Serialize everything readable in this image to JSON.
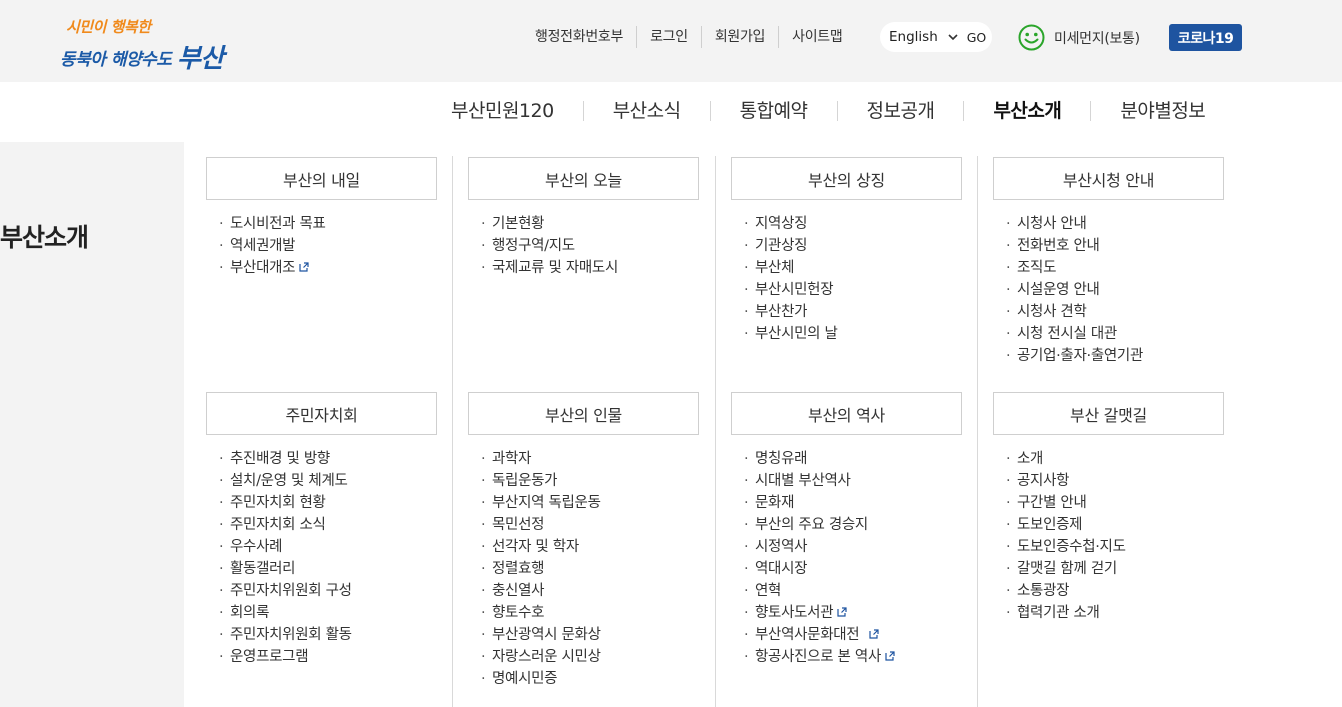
{
  "logo": {
    "line1": "시민이 행복한",
    "line2": "동북아 해양수도",
    "line2_big": "부산"
  },
  "util_links": [
    "행정전화번호부",
    "로그인",
    "회원가입",
    "사이트맵"
  ],
  "language": {
    "selected": "English",
    "go": "GO"
  },
  "dust": {
    "label": "미세먼지(보통)",
    "color": "#2aa52a"
  },
  "covid_button": "코로나19",
  "gnb": [
    {
      "label": "부산민원120",
      "active": false
    },
    {
      "label": "부산소식",
      "active": false
    },
    {
      "label": "통합예약",
      "active": false
    },
    {
      "label": "정보공개",
      "active": false
    },
    {
      "label": "부산소개",
      "active": true
    },
    {
      "label": "분야별정보",
      "active": false
    }
  ],
  "side_title": "부산소개",
  "sections": [
    {
      "title": "부산의 내일",
      "items": [
        {
          "label": "도시비전과 목표"
        },
        {
          "label": "역세권개발"
        },
        {
          "label": "부산대개조",
          "external": true
        }
      ]
    },
    {
      "title": "부산의 오늘",
      "items": [
        {
          "label": "기본현황"
        },
        {
          "label": "행정구역/지도"
        },
        {
          "label": "국제교류 및 자매도시"
        }
      ]
    },
    {
      "title": "부산의 상징",
      "items": [
        {
          "label": "지역상징"
        },
        {
          "label": "기관상징"
        },
        {
          "label": "부산체"
        },
        {
          "label": "부산시민헌장"
        },
        {
          "label": "부산찬가"
        },
        {
          "label": "부산시민의 날"
        }
      ]
    },
    {
      "title": "부산시청 안내",
      "items": [
        {
          "label": "시청사 안내"
        },
        {
          "label": "전화번호 안내"
        },
        {
          "label": "조직도"
        },
        {
          "label": "시설운영 안내"
        },
        {
          "label": "시청사 견학"
        },
        {
          "label": "시청 전시실 대관"
        },
        {
          "label": "공기업·출자·출연기관"
        }
      ]
    },
    {
      "title": "주민자치회",
      "items": [
        {
          "label": "추진배경 및 방향"
        },
        {
          "label": "설치/운영 및 체계도"
        },
        {
          "label": "주민자치회 현황"
        },
        {
          "label": "주민자치회 소식"
        },
        {
          "label": "우수사례"
        },
        {
          "label": "활동갤러리"
        },
        {
          "label": "주민자치위원회 구성"
        },
        {
          "label": "회의록"
        },
        {
          "label": "주민자치위원회 활동"
        },
        {
          "label": "운영프로그램"
        }
      ]
    },
    {
      "title": "부산의 인물",
      "items": [
        {
          "label": "과학자"
        },
        {
          "label": "독립운동가"
        },
        {
          "label": "부산지역 독립운동"
        },
        {
          "label": "목민선정"
        },
        {
          "label": "선각자 및 학자"
        },
        {
          "label": "정렬효행"
        },
        {
          "label": "충신열사"
        },
        {
          "label": "향토수호"
        },
        {
          "label": "부산광역시 문화상"
        },
        {
          "label": "자랑스러운 시민상"
        },
        {
          "label": "명예시민증"
        }
      ]
    },
    {
      "title": "부산의 역사",
      "items": [
        {
          "label": "명칭유래"
        },
        {
          "label": "시대별 부산역사"
        },
        {
          "label": "문화재"
        },
        {
          "label": "부산의 주요 경승지"
        },
        {
          "label": "시정역사"
        },
        {
          "label": "역대시장"
        },
        {
          "label": "연혁"
        },
        {
          "label": "향토사도서관",
          "external": true
        },
        {
          "label": "부산역사문화대전",
          "external": true
        },
        {
          "label": "항공사진으로 본 역사",
          "external": true
        }
      ]
    },
    {
      "title": "부산 갈맷길",
      "items": [
        {
          "label": "소개"
        },
        {
          "label": "공지사항"
        },
        {
          "label": "구간별 안내"
        },
        {
          "label": "도보인증제"
        },
        {
          "label": "도보인증수첩·지도"
        },
        {
          "label": "갈맷길 함께 걷기"
        },
        {
          "label": "소통광장"
        },
        {
          "label": "협력기관 소개"
        }
      ]
    }
  ]
}
